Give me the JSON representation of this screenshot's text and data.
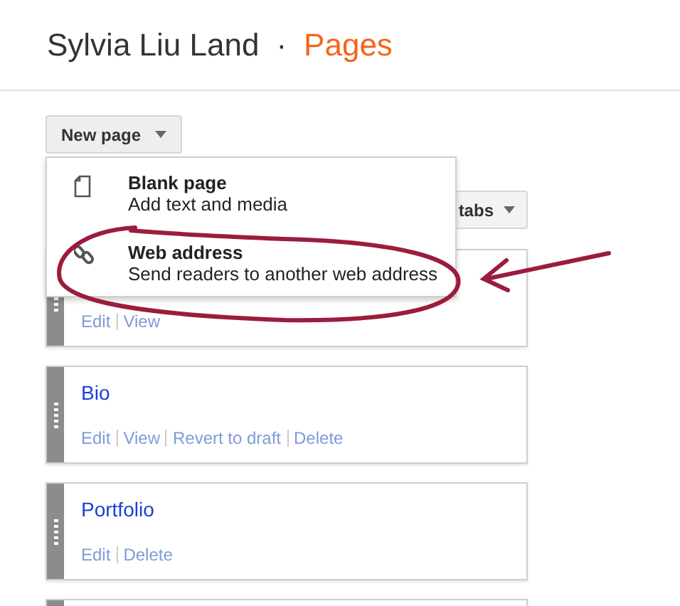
{
  "header": {
    "site_title": "Sylvia Liu Land",
    "separator": "·",
    "section": "Pages"
  },
  "new_page_button": {
    "label": "New page"
  },
  "new_page_menu": {
    "items": [
      {
        "kind": "blank",
        "title": "Blank page",
        "description": "Add text and media"
      },
      {
        "kind": "link",
        "title": "Web address",
        "description": "Send readers to another web address"
      }
    ]
  },
  "tabs_button": {
    "label": "tabs"
  },
  "pages": [
    {
      "kind": "page",
      "actions": [
        "Edit",
        "View"
      ]
    },
    {
      "kind": "page",
      "title": "Bio",
      "actions": [
        "Edit",
        "View",
        "Revert to draft",
        "Delete"
      ]
    },
    {
      "kind": "page",
      "title": "Portfolio",
      "actions": [
        "Edit",
        "Delete"
      ]
    },
    {
      "kind": "page"
    }
  ]
}
